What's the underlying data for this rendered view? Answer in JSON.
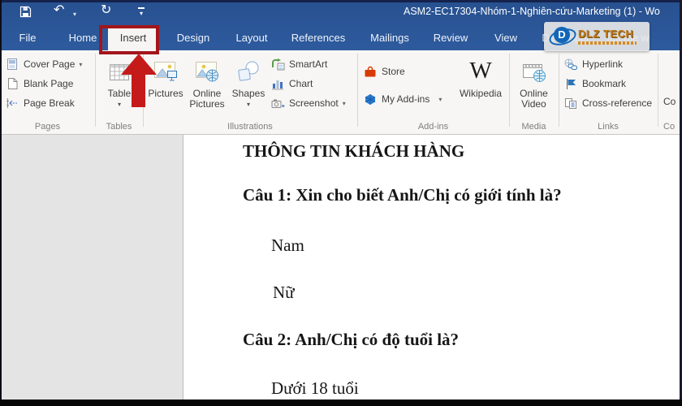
{
  "colors": {
    "titlebar_blue": "#2b579a",
    "annotation_red": "#b3181d",
    "store_orange": "#d83b01",
    "addin_blue": "#2b7cd3",
    "watermark_orange": "#c07a1a"
  },
  "ui": {
    "caret": "▾"
  },
  "titlebar": {
    "title": "ASM2-EC17304-Nhóm-1-Nghiên-cứu-Marketing (1) - Wo",
    "undo_glyph": "↶",
    "redo_glyph": "↻"
  },
  "tabs": [
    {
      "label": "File"
    },
    {
      "label": "Home"
    },
    {
      "label": "Insert",
      "active": true,
      "highlighted": true
    },
    {
      "label": "Design"
    },
    {
      "label": "Layout"
    },
    {
      "label": "References"
    },
    {
      "label": "Mailings"
    },
    {
      "label": "Review"
    },
    {
      "label": "View"
    },
    {
      "label": "Developer"
    }
  ],
  "tellme": {
    "label": "Tell me w"
  },
  "ribbon": {
    "pages": {
      "label": "Pages",
      "cover_page": "Cover Page",
      "blank_page": "Blank Page",
      "page_break": "Page Break"
    },
    "tables": {
      "label": "Tables",
      "table": "Table"
    },
    "illustrations": {
      "label": "Illustrations",
      "pictures": "Pictures",
      "online_pictures_line1": "Online",
      "online_pictures_line2": "Pictures",
      "shapes": "Shapes",
      "smartart": "SmartArt",
      "chart": "Chart",
      "screenshot": "Screenshot"
    },
    "addins": {
      "label": "Add-ins",
      "store": "Store",
      "my_addins": "My Add-ins",
      "wikipedia": "Wikipedia",
      "wikipedia_glyph": "W"
    },
    "media": {
      "label": "Media",
      "online_video_line1": "Online",
      "online_video_line2": "Video"
    },
    "links": {
      "label": "Links",
      "hyperlink": "Hyperlink",
      "bookmark": "Bookmark",
      "cross_reference": "Cross-reference"
    },
    "comments": {
      "label": "Co",
      "button": "Co"
    }
  },
  "watermark": {
    "brand": "DLZ TECH",
    "logo_letter": "D"
  },
  "document": {
    "heading": "THÔNG TIN KHÁCH HÀNG",
    "question1": "Câu 1: Xin cho biết Anh/Chị có giới tính là?",
    "option1a": "Nam",
    "option1b": "Nữ",
    "question2": "Câu 2: Anh/Chị có độ tuổi là?",
    "option2a": "Dưới 18 tuổi"
  }
}
